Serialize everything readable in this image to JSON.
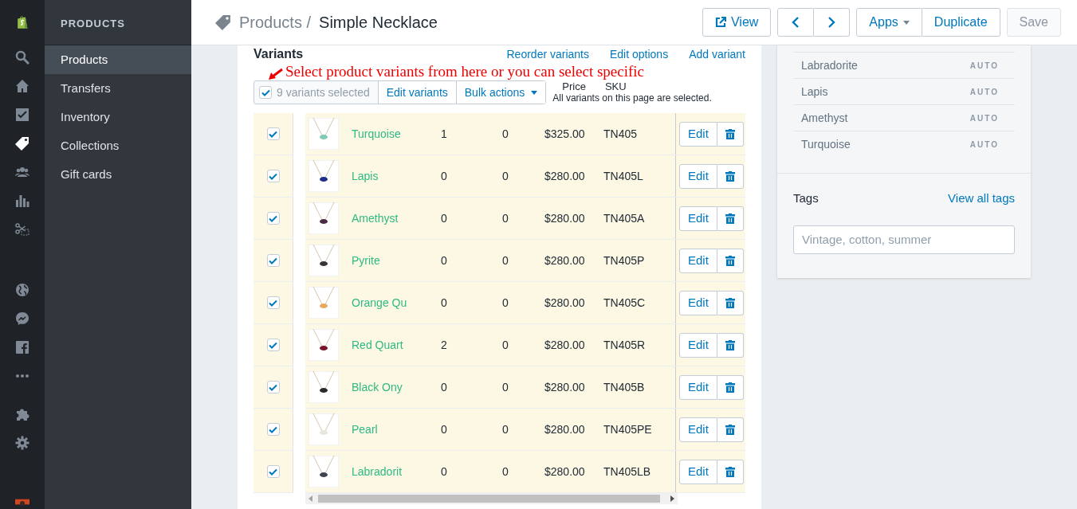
{
  "rail_items": [
    {
      "selected": false
    },
    {
      "selected": false
    },
    {
      "selected": false
    },
    {
      "selected": true
    },
    {
      "selected": false
    },
    {
      "selected": false
    },
    {
      "selected": false
    },
    {
      "selected": false
    },
    {
      "selected": false
    },
    {
      "selected": false
    },
    {
      "selected": false
    },
    {
      "selected": false
    },
    {
      "selected": false
    }
  ],
  "sidebar": {
    "heading": "PRODUCTS",
    "items": [
      {
        "label": "Products",
        "selected": true
      },
      {
        "label": "Transfers",
        "selected": false
      },
      {
        "label": "Inventory",
        "selected": false
      },
      {
        "label": "Collections",
        "selected": false
      },
      {
        "label": "Gift cards",
        "selected": false
      }
    ]
  },
  "header": {
    "breadcrumb": "Products /",
    "title": "Simple Necklace",
    "view_button": "View",
    "apps_button": "Apps",
    "duplicate_button": "Duplicate",
    "save_button": {
      "label": "Save",
      "disabled": true
    }
  },
  "variants": {
    "title": "Variants",
    "links": [
      "Reorder variants",
      "Edit options",
      "Add variant"
    ],
    "annotation": "Select product variants from here or you can select specific",
    "toolbar": {
      "checked": true,
      "selected_count": "9 variants selected",
      "edit_button": "Edit variants",
      "bulk_button": "Bulk actions"
    },
    "columns": [
      "Price",
      "SKU"
    ],
    "notice": "All variants on this page are selected.",
    "rows": [
      {
        "selected": true,
        "name": "Turquoise",
        "column_3": "1",
        "column_4": "0",
        "price": "$325.00",
        "sku": "TN405",
        "edit": "Edit"
      },
      {
        "selected": true,
        "name": "Lapis",
        "column_3": "0",
        "column_4": "0",
        "price": "$280.00",
        "sku": "TN405L",
        "edit": "Edit"
      },
      {
        "selected": true,
        "name": "Amethyst",
        "column_3": "0",
        "column_4": "0",
        "price": "$280.00",
        "sku": "TN405A",
        "edit": "Edit"
      },
      {
        "selected": true,
        "name": "Pyrite",
        "column_3": "0",
        "column_4": "0",
        "price": "$280.00",
        "sku": "TN405P",
        "edit": "Edit"
      },
      {
        "selected": true,
        "name": "Orange Qu",
        "column_3": "0",
        "column_4": "0",
        "price": "$280.00",
        "sku": "TN405C",
        "edit": "Edit"
      },
      {
        "selected": true,
        "name": "Red Quart",
        "column_3": "2",
        "column_4": "0",
        "price": "$280.00",
        "sku": "TN405R",
        "edit": "Edit"
      },
      {
        "selected": true,
        "name": "Black Ony",
        "column_3": "0",
        "column_4": "0",
        "price": "$280.00",
        "sku": "TN405B",
        "edit": "Edit"
      },
      {
        "selected": true,
        "name": "Pearl",
        "column_3": "0",
        "column_4": "0",
        "price": "$280.00",
        "sku": "TN405PE",
        "edit": "Edit"
      },
      {
        "selected": true,
        "name": "Labradorit",
        "column_3": "0",
        "column_4": "0",
        "price": "$280.00",
        "sku": "TN405LB",
        "edit": "Edit"
      }
    ]
  },
  "option_values": [
    {
      "label": "Labradorite",
      "badge": "AUTO"
    },
    {
      "label": "Lapis",
      "badge": "AUTO"
    },
    {
      "label": "Amethyst",
      "badge": "AUTO"
    },
    {
      "label": "Turquoise",
      "badge": "AUTO"
    }
  ],
  "tags": {
    "label": "Tags",
    "link": "View all tags",
    "placeholder": "Vintage, cotton, summer"
  }
}
